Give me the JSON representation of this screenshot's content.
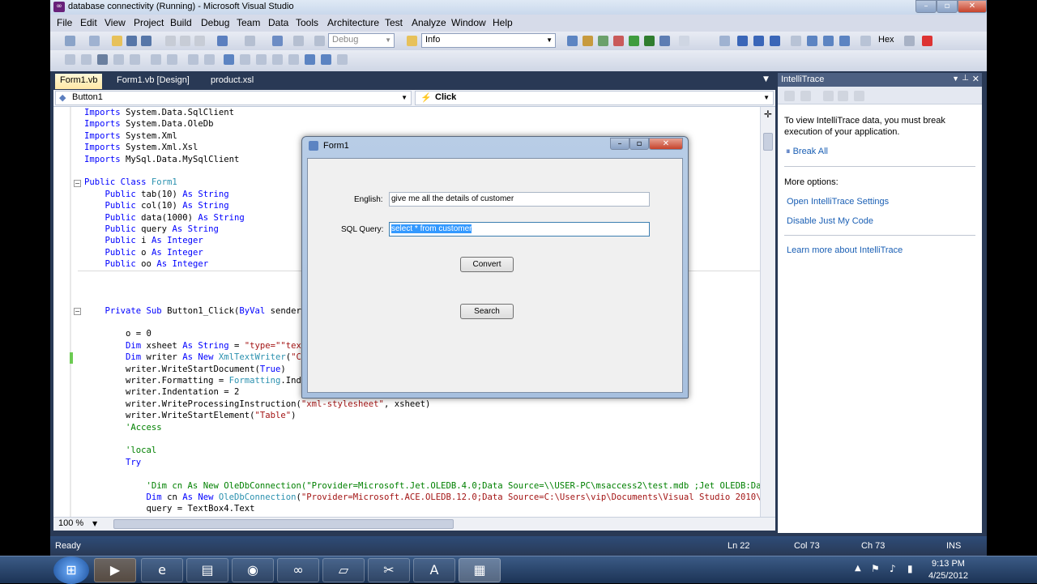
{
  "window": {
    "title": "database connectivity (Running) - Microsoft Visual Studio"
  },
  "menu": [
    "File",
    "Edit",
    "View",
    "Project",
    "Build",
    "Debug",
    "Team",
    "Data",
    "Tools",
    "Architecture",
    "Test",
    "Analyze",
    "Window",
    "Help"
  ],
  "toolbar": {
    "config": "Debug",
    "find": "Info",
    "hex_label": "Hex"
  },
  "tabs": [
    "Form1.vb",
    "Form1.vb [Design]",
    "product.xsl"
  ],
  "navbar": {
    "object": "Button1",
    "event": "Click"
  },
  "code": [
    [
      "kw",
      "Imports "
    ],
    [
      "",
      "System.Data.SqlClient"
    ],
    [
      "kw",
      "Imports "
    ],
    [
      "",
      "System.Data.OleDb"
    ],
    [
      "kw",
      "Imports "
    ],
    [
      "",
      "System.Xml"
    ],
    [
      "kw",
      "Imports "
    ],
    [
      "",
      "System.Xml.Xsl"
    ],
    [
      "kw",
      "Imports "
    ],
    [
      "",
      "MySql.Data.MySqlClient"
    ]
  ],
  "form": {
    "title": "Form1",
    "english_label": "English:",
    "english_value": "give me all the details of customer",
    "sql_label": "SQL Query:",
    "sql_value": "select * from customer",
    "convert": "Convert",
    "search": "Search"
  },
  "panel": {
    "title": "IntelliTrace",
    "message": "To view IntelliTrace data, you must break execution of your application.",
    "break_all": "Break All",
    "more_options": "More options:",
    "open_settings": "Open IntelliTrace Settings",
    "disable_jmc": "Disable Just My Code",
    "learn_more": "Learn more about IntelliTrace"
  },
  "editor": {
    "zoom": "100 %"
  },
  "status": {
    "ready": "Ready",
    "ln": "Ln 22",
    "col": "Col 73",
    "ch": "Ch 73",
    "ins": "INS"
  },
  "clock": {
    "time": "9:13 PM",
    "date": "4/25/2012"
  }
}
